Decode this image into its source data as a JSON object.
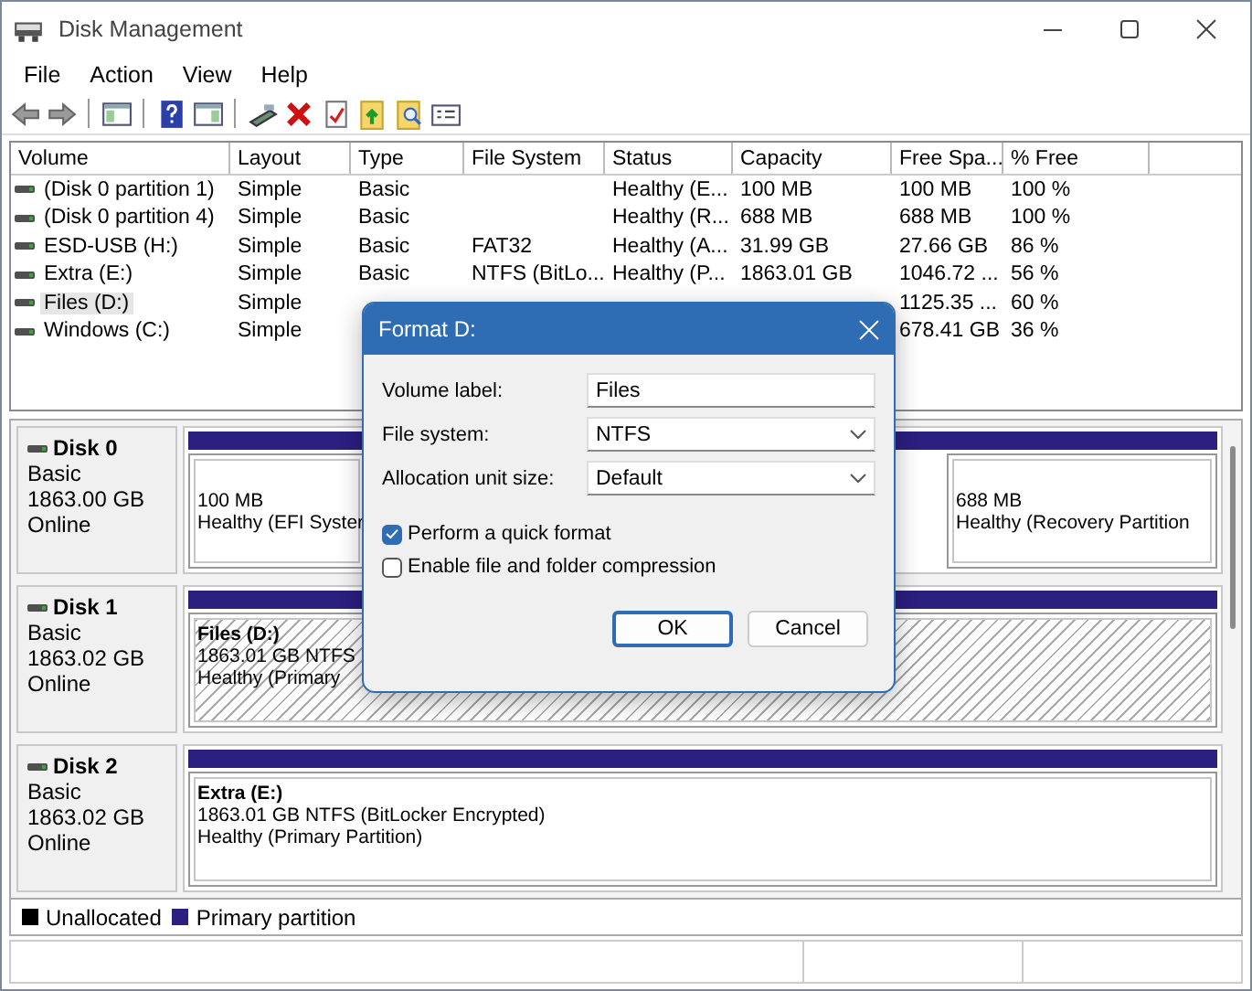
{
  "window": {
    "title": "Disk Management"
  },
  "menu": [
    "File",
    "Action",
    "View",
    "Help"
  ],
  "table": {
    "columns": [
      "Volume",
      "Layout",
      "Type",
      "File System",
      "Status",
      "Capacity",
      "Free Spa...",
      "% Free"
    ],
    "rows": [
      {
        "cells": [
          "(Disk 0 partition 1)",
          "Simple",
          "Basic",
          "",
          "Healthy (E...",
          "100 MB",
          "100 MB",
          "100 %"
        ],
        "selected": false
      },
      {
        "cells": [
          "(Disk 0 partition 4)",
          "Simple",
          "Basic",
          "",
          "Healthy (R...",
          "688 MB",
          "688 MB",
          "100 %"
        ],
        "selected": false
      },
      {
        "cells": [
          "ESD-USB (H:)",
          "Simple",
          "Basic",
          "FAT32",
          "Healthy (A...",
          "31.99 GB",
          "27.66 GB",
          "86 %"
        ],
        "selected": false
      },
      {
        "cells": [
          "Extra (E:)",
          "Simple",
          "Basic",
          "NTFS (BitLo...",
          "Healthy (P...",
          "1863.01 GB",
          "1046.72 ...",
          "56 %"
        ],
        "selected": false
      },
      {
        "cells": [
          "Files (D:)",
          "Simple",
          "",
          "",
          "",
          "",
          "1125.35 ...",
          "60 %"
        ],
        "selected": true
      },
      {
        "cells": [
          "Windows (C:)",
          "Simple",
          "",
          "",
          "",
          "",
          "678.41 GB",
          "36 %"
        ],
        "selected": false
      }
    ]
  },
  "disks": [
    {
      "name": "Disk 0",
      "lines": [
        "Basic",
        "1863.00 GB",
        "Online"
      ],
      "partitions": [
        {
          "lines": [
            "100 MB",
            "Healthy (EFI Syster"
          ],
          "selected": false
        },
        {
          "lines": [
            "688 MB",
            "Healthy (Recovery Partition"
          ],
          "selected": false
        }
      ]
    },
    {
      "name": "Disk 1",
      "lines": [
        "Basic",
        "1863.02 GB",
        "Online"
      ],
      "partitions": [
        {
          "title": "Files  (D:)",
          "lines": [
            "1863.01 GB NTFS",
            "Healthy (Primary"
          ],
          "selected": true
        }
      ]
    },
    {
      "name": "Disk 2",
      "lines": [
        "Basic",
        "1863.02 GB",
        "Online"
      ],
      "partitions": [
        {
          "title": "Extra  (E:)",
          "lines": [
            "1863.01 GB NTFS (BitLocker Encrypted)",
            "Healthy (Primary Partition)"
          ],
          "selected": false
        }
      ]
    }
  ],
  "legend": [
    {
      "label": "Unallocated",
      "color": "#000000"
    },
    {
      "label": "Primary partition",
      "color": "#2b1f7f"
    }
  ],
  "dialog": {
    "title": "Format D:",
    "fields": [
      {
        "kind": "input",
        "label": "Volume label:",
        "value": "Files"
      },
      {
        "kind": "select",
        "label": "File system:",
        "value": "NTFS"
      },
      {
        "kind": "select",
        "label": "Allocation unit size:",
        "value": "Default"
      }
    ],
    "options": [
      {
        "label": "Perform a quick format",
        "checked": true
      },
      {
        "label": "Enable file and folder compression",
        "checked": false
      }
    ],
    "buttons": [
      {
        "label": "OK",
        "default": true
      },
      {
        "label": "Cancel",
        "default": false
      }
    ]
  }
}
